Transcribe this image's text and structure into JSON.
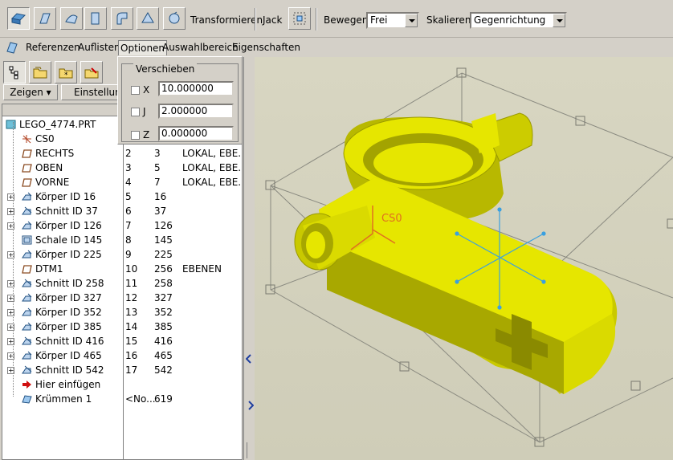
{
  "toolbar": {
    "buttons": [
      "translate-move-icon",
      "rotate-icon",
      "normal-move-icon",
      "plane-move-icon",
      "curve-move-icon",
      "edge-move-icon",
      "drag-rotate-icon"
    ],
    "transform_label": "Transformieren",
    "jack_label": "Jack",
    "move_label": "Bewegen",
    "move_value": "Frei",
    "scale_label": "Skalieren",
    "scale_value": "Gegenrichtung"
  },
  "tabs": [
    "Referenzen",
    "Auflisten",
    "Optionen",
    "Auswahlbereich",
    "Eigenschaften"
  ],
  "active_tab": "Optionen",
  "panel": {
    "show_label": "Zeigen ▾",
    "settings_label": "Einstellung"
  },
  "options_popup": {
    "group_title": "Verschieben",
    "axes": [
      {
        "label": "X",
        "value": "10.000000",
        "checked": false
      },
      {
        "label": "J",
        "value": "2.000000",
        "checked": false
      },
      {
        "label": "Z",
        "value": "0.000000",
        "checked": false
      }
    ]
  },
  "tree": [
    {
      "name": "LEGO_4774.PRT",
      "icon": "part-icon",
      "c1": "",
      "c2": "",
      "c3": "",
      "expand": false,
      "level": 0
    },
    {
      "name": "CS0",
      "icon": "coordinate-system-icon",
      "c1": "",
      "c2": "",
      "c3": "",
      "expand": false,
      "level": 1
    },
    {
      "name": "RECHTS",
      "icon": "datum-plane-icon",
      "c1": "2",
      "c2": "3",
      "c3": "LOKAL, EBE...",
      "expand": false,
      "level": 1
    },
    {
      "name": "OBEN",
      "icon": "datum-plane-icon",
      "c1": "3",
      "c2": "5",
      "c3": "LOKAL, EBE...",
      "expand": false,
      "level": 1
    },
    {
      "name": "VORNE",
      "icon": "datum-plane-icon",
      "c1": "4",
      "c2": "7",
      "c3": "LOKAL, EBE...",
      "expand": false,
      "level": 1
    },
    {
      "name": "Körper ID 16",
      "icon": "body-icon",
      "c1": "5",
      "c2": "16",
      "c3": "",
      "expand": true,
      "level": 1
    },
    {
      "name": "Schnitt ID 37",
      "icon": "cut-icon",
      "c1": "6",
      "c2": "37",
      "c3": "",
      "expand": true,
      "level": 1
    },
    {
      "name": "Körper ID 126",
      "icon": "body-icon",
      "c1": "7",
      "c2": "126",
      "c3": "",
      "expand": true,
      "level": 1
    },
    {
      "name": "Schale ID 145",
      "icon": "shell-icon",
      "c1": "8",
      "c2": "145",
      "c3": "",
      "expand": false,
      "level": 1
    },
    {
      "name": "Körper ID 225",
      "icon": "body-icon",
      "c1": "9",
      "c2": "225",
      "c3": "",
      "expand": true,
      "level": 1
    },
    {
      "name": "DTM1",
      "icon": "datum-plane-icon",
      "c1": "10",
      "c2": "256",
      "c3": "EBENEN",
      "expand": false,
      "level": 1
    },
    {
      "name": "Schnitt ID 258",
      "icon": "cut-icon",
      "c1": "11",
      "c2": "258",
      "c3": "",
      "expand": true,
      "level": 1
    },
    {
      "name": "Körper ID 327",
      "icon": "body-icon",
      "c1": "12",
      "c2": "327",
      "c3": "",
      "expand": true,
      "level": 1
    },
    {
      "name": "Körper ID 352",
      "icon": "body-icon",
      "c1": "13",
      "c2": "352",
      "c3": "",
      "expand": true,
      "level": 1
    },
    {
      "name": "Körper ID 385",
      "icon": "body-icon",
      "c1": "14",
      "c2": "385",
      "c3": "",
      "expand": true,
      "level": 1
    },
    {
      "name": "Schnitt ID 416",
      "icon": "cut-icon",
      "c1": "15",
      "c2": "416",
      "c3": "",
      "expand": true,
      "level": 1
    },
    {
      "name": "Körper ID 465",
      "icon": "body-icon",
      "c1": "16",
      "c2": "465",
      "c3": "",
      "expand": true,
      "level": 1
    },
    {
      "name": "Schnitt ID 542",
      "icon": "cut-icon",
      "c1": "17",
      "c2": "542",
      "c3": "",
      "expand": true,
      "level": 1
    },
    {
      "name": "Hier einfügen",
      "icon": "insert-here-arrow-icon",
      "c1": "",
      "c2": "",
      "c3": "",
      "expand": false,
      "level": 1
    },
    {
      "name": "Krümmen 1",
      "icon": "warp-icon",
      "c1": "<No...",
      "c2": "619",
      "c3": "",
      "expand": false,
      "level": 1
    }
  ],
  "viewport": {
    "csys_label": "CS0",
    "model_color": "#e6e600",
    "background": "#d3d1bd"
  }
}
